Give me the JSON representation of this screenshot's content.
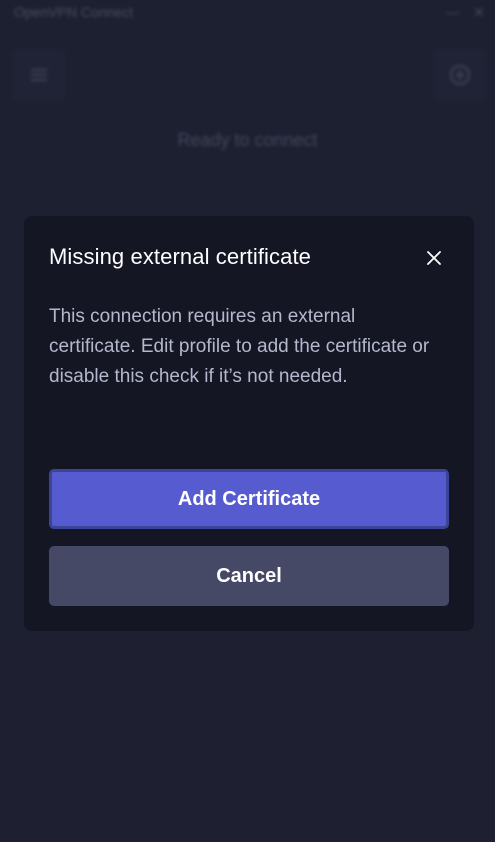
{
  "window": {
    "title": "OpenVPN Connect",
    "minimize_label": "—",
    "close_label": "✕"
  },
  "background": {
    "status_text": "Ready to connect"
  },
  "dialog": {
    "title": "Missing external certificate",
    "body": "This connection requires an external certificate. Edit profile to add the certificate or disable this check if it’s not needed.",
    "primary_button": "Add Certificate",
    "secondary_button": "Cancel"
  },
  "colors": {
    "background": "#23263a",
    "dialog_bg": "#151624",
    "primary": "#575bd0",
    "secondary": "#464965"
  },
  "icons": {
    "close": "close-icon",
    "menu": "menu-icon",
    "import": "import-icon"
  }
}
